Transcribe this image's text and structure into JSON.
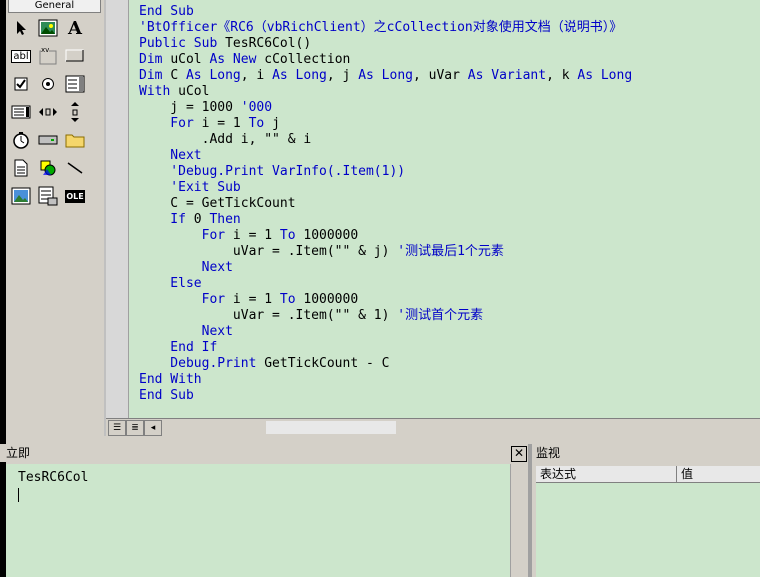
{
  "toolbox": {
    "tab_label": "General",
    "tools": [
      {
        "name": "pointer-icon"
      },
      {
        "name": "picturebox-icon"
      },
      {
        "name": "label-icon"
      },
      {
        "name": "textbox-icon"
      },
      {
        "name": "frame-icon"
      },
      {
        "name": "commandbutton-icon"
      },
      {
        "name": "checkbox-icon"
      },
      {
        "name": "optionbutton-icon"
      },
      {
        "name": "combobox-icon"
      },
      {
        "name": "listbox-icon"
      },
      {
        "name": "hscrollbar-icon"
      },
      {
        "name": "vscrollbar-icon"
      },
      {
        "name": "timer-icon"
      },
      {
        "name": "drivelistbox-icon"
      },
      {
        "name": "dirlistbox-icon"
      },
      {
        "name": "filelistbox-icon"
      },
      {
        "name": "shape-icon"
      },
      {
        "name": "line-icon"
      },
      {
        "name": "image-icon"
      },
      {
        "name": "data-icon"
      },
      {
        "name": "ole-icon"
      }
    ],
    "label_glyph": "A",
    "textbox_glyph": "abl",
    "frame_glyph": "xv",
    "ole_glyph": "OLE"
  },
  "code": {
    "lines": [
      [
        {
          "t": "End Sub",
          "c": "kw"
        }
      ],
      [
        {
          "t": "'BtOfficer《RC6（vbRichClient）之cCollection对象使用文档（说明书）》",
          "c": "cm"
        }
      ],
      [
        {
          "t": "Public Sub ",
          "c": "kw"
        },
        {
          "t": "TesRC6Col()",
          "c": "nm"
        }
      ],
      [
        {
          "t": "Dim ",
          "c": "kw"
        },
        {
          "t": "uCol ",
          "c": "nm"
        },
        {
          "t": "As New ",
          "c": "kw"
        },
        {
          "t": "cCollection",
          "c": "nm"
        }
      ],
      [
        {
          "t": "Dim ",
          "c": "kw"
        },
        {
          "t": "C ",
          "c": "nm"
        },
        {
          "t": "As Long",
          "c": "kw"
        },
        {
          "t": ", i ",
          "c": "nm"
        },
        {
          "t": "As Long",
          "c": "kw"
        },
        {
          "t": ", j ",
          "c": "nm"
        },
        {
          "t": "As Long",
          "c": "kw"
        },
        {
          "t": ", uVar ",
          "c": "nm"
        },
        {
          "t": "As Variant",
          "c": "kw"
        },
        {
          "t": ", k ",
          "c": "nm"
        },
        {
          "t": "As Long",
          "c": "kw"
        }
      ],
      [
        {
          "t": "With ",
          "c": "kw"
        },
        {
          "t": "uCol",
          "c": "nm"
        }
      ],
      [
        {
          "t": "    j = 1000 ",
          "c": "nm"
        },
        {
          "t": "'000",
          "c": "cm"
        }
      ],
      [
        {
          "t": "    For ",
          "c": "kw"
        },
        {
          "t": "i = 1 ",
          "c": "nm"
        },
        {
          "t": "To ",
          "c": "kw"
        },
        {
          "t": "j",
          "c": "nm"
        }
      ],
      [
        {
          "t": "        .Add i, \"\" & i",
          "c": "nm"
        }
      ],
      [
        {
          "t": "    Next",
          "c": "kw"
        }
      ],
      [
        {
          "t": "    'Debug.Print VarInfo(.Item(1))",
          "c": "cm"
        }
      ],
      [
        {
          "t": "    'Exit Sub",
          "c": "cm"
        }
      ],
      [
        {
          "t": "    C = GetTickCount",
          "c": "nm"
        }
      ],
      [
        {
          "t": "    If ",
          "c": "kw"
        },
        {
          "t": "0 ",
          "c": "nm"
        },
        {
          "t": "Then",
          "c": "kw"
        }
      ],
      [
        {
          "t": "        For ",
          "c": "kw"
        },
        {
          "t": "i = 1 ",
          "c": "nm"
        },
        {
          "t": "To ",
          "c": "kw"
        },
        {
          "t": "1000000",
          "c": "nm"
        }
      ],
      [
        {
          "t": "            uVar = .Item(\"\" & j) ",
          "c": "nm"
        },
        {
          "t": "'测试最后1个元素",
          "c": "cm"
        }
      ],
      [
        {
          "t": "        Next",
          "c": "kw"
        }
      ],
      [
        {
          "t": "    Else",
          "c": "kw"
        }
      ],
      [
        {
          "t": "        For ",
          "c": "kw"
        },
        {
          "t": "i = 1 ",
          "c": "nm"
        },
        {
          "t": "To ",
          "c": "kw"
        },
        {
          "t": "1000000",
          "c": "nm"
        }
      ],
      [
        {
          "t": "            uVar = .Item(\"\" & 1) ",
          "c": "nm"
        },
        {
          "t": "'测试首个元素",
          "c": "cm"
        }
      ],
      [
        {
          "t": "        Next",
          "c": "kw"
        }
      ],
      [
        {
          "t": "    End If",
          "c": "kw"
        }
      ],
      [
        {
          "t": "    Debug.Print ",
          "c": "kw"
        },
        {
          "t": "GetTickCount - C",
          "c": "nm"
        }
      ],
      [
        {
          "t": "End With",
          "c": "kw"
        }
      ],
      [
        {
          "t": "End Sub",
          "c": "kw"
        }
      ]
    ]
  },
  "immediate": {
    "title": "立即",
    "close_label": "✕",
    "content": "TesRC6Col"
  },
  "watch": {
    "title": "监视",
    "columns": [
      "表达式",
      "值"
    ]
  },
  "colors": {
    "code_bg": "#cce6cc",
    "keyword": "#0000c8"
  }
}
